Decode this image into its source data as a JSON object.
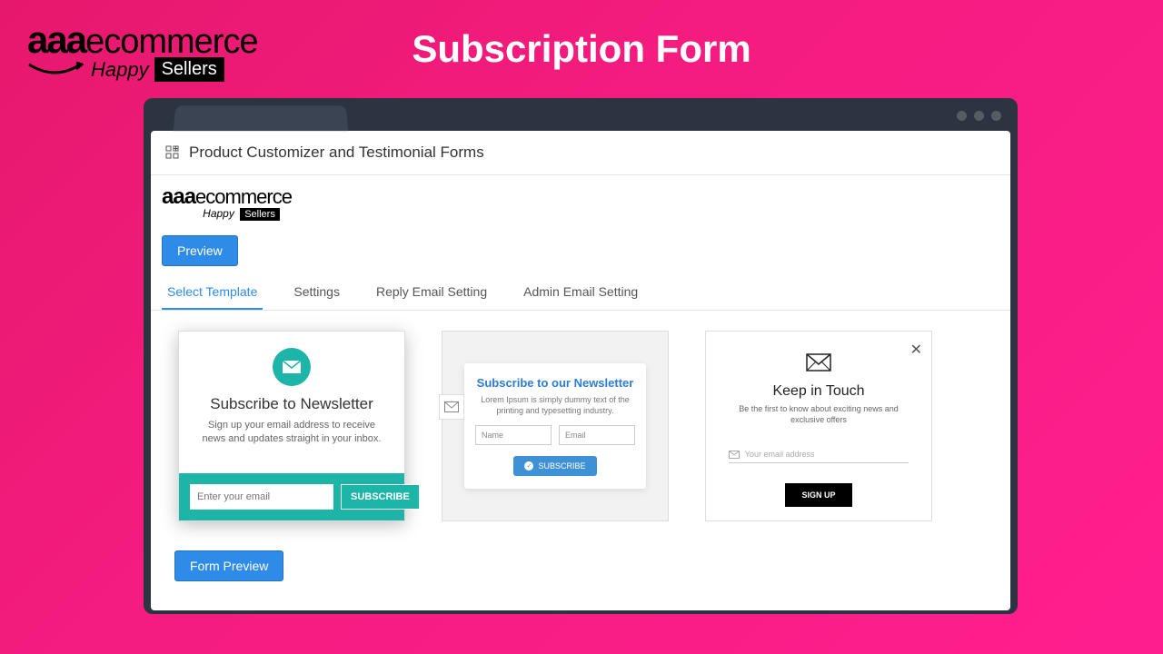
{
  "brand": {
    "aaa": "aaa",
    "ecom": "ecommerce",
    "happy": "Happy",
    "sellers": "Sellers"
  },
  "page_title": "Subscription Form",
  "app": {
    "header_title": "Product Customizer and Testimonial Forms",
    "preview_btn": "Preview",
    "form_preview_btn": "Form Preview",
    "tabs": [
      {
        "label": "Select Template",
        "active": true
      },
      {
        "label": "Settings",
        "active": false
      },
      {
        "label": "Reply Email Setting",
        "active": false
      },
      {
        "label": "Admin Email Setting",
        "active": false
      }
    ]
  },
  "templates": {
    "t1": {
      "title": "Subscribe to Newsletter",
      "desc": "Sign up your email address to receive news and updates straight in your inbox.",
      "placeholder": "Enter your email",
      "btn": "SUBSCRIBE"
    },
    "t2": {
      "title": "Subscribe to our Newsletter",
      "desc": "Lorem Ipsum is simply dummy text of the printing and typesetting industry.",
      "name_ph": "Name",
      "email_ph": "Email",
      "btn": "SUBSCRIBE"
    },
    "t3": {
      "title": "Keep in Touch",
      "desc": "Be the first to know about exciting news and exclusive offers",
      "placeholder": "Your email address",
      "btn": "SIGN UP"
    }
  },
  "colors": {
    "accent": "#2f8be8",
    "teal": "#1db5a8",
    "bg_gradient_from": "#e6186d",
    "bg_gradient_to": "#ff1e8e"
  }
}
